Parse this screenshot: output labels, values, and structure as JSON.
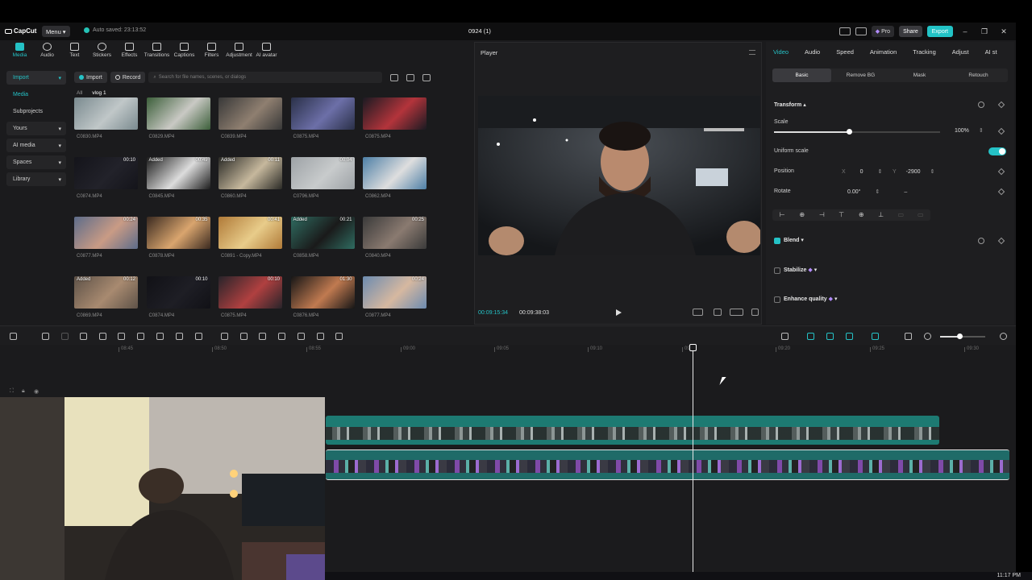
{
  "titlebar": {
    "brand": "CapCut",
    "menu_label": "Menu",
    "autosave": "Auto saved: 23:13:52",
    "project_title": "0924 (1)",
    "pro_label": "Pro",
    "share_label": "Share",
    "export_label": "Export",
    "accent_color": "#25c2c6"
  },
  "tools": [
    {
      "label": "Media",
      "icon": "media-icon"
    },
    {
      "label": "Audio",
      "icon": "audio-icon"
    },
    {
      "label": "Text",
      "icon": "text-icon"
    },
    {
      "label": "Stickers",
      "icon": "stickers-icon"
    },
    {
      "label": "Effects",
      "icon": "effects-icon"
    },
    {
      "label": "Transitions",
      "icon": "transitions-icon"
    },
    {
      "label": "Captions",
      "icon": "captions-icon"
    },
    {
      "label": "Filters",
      "icon": "filters-icon"
    },
    {
      "label": "Adjustment",
      "icon": "adjustment-icon"
    },
    {
      "label": "AI avatar",
      "icon": "ai-avatar-icon"
    }
  ],
  "leftnav": [
    {
      "label": "Import"
    },
    {
      "label": "Media"
    },
    {
      "label": "Subprojects"
    },
    {
      "label": "Yours"
    },
    {
      "label": "AI media"
    },
    {
      "label": "Spaces"
    },
    {
      "label": "Library"
    }
  ],
  "media": {
    "import_label": "Import",
    "record_label": "Record",
    "search_placeholder": "Search for file names, scenes, or dialogs",
    "crumbs": [
      "All",
      "vlog 1"
    ],
    "items": [
      {
        "name": "C0830.MP4",
        "duration": "",
        "added": ""
      },
      {
        "name": "C0829.MP4",
        "duration": "",
        "added": ""
      },
      {
        "name": "C0839.MP4",
        "duration": "",
        "added": ""
      },
      {
        "name": "C0875.MP4",
        "duration": "",
        "added": ""
      },
      {
        "name": "C0875.MP4",
        "duration": "",
        "added": ""
      },
      {
        "name": "C0874.MP4",
        "duration": "00:10",
        "added": ""
      },
      {
        "name": "C0845.MP4",
        "duration": "00:49",
        "added": "Added"
      },
      {
        "name": "C0860.MP4",
        "duration": "00:11",
        "added": "Added"
      },
      {
        "name": "C0796.MP4",
        "duration": "00:04",
        "added": ""
      },
      {
        "name": "C0862.MP4",
        "duration": "",
        "added": ""
      },
      {
        "name": "C0877.MP4",
        "duration": "00:24",
        "added": ""
      },
      {
        "name": "C0878.MP4",
        "duration": "00:35",
        "added": ""
      },
      {
        "name": "C0891 - Copy.MP4",
        "duration": "00:41",
        "added": ""
      },
      {
        "name": "C0858.MP4",
        "duration": "00:21",
        "added": "Added"
      },
      {
        "name": "C0840.MP4",
        "duration": "00:25",
        "added": ""
      },
      {
        "name": "C0869.MP4",
        "duration": "00:12",
        "added": "Added"
      },
      {
        "name": "C0874.MP4",
        "duration": "00:10",
        "added": ""
      },
      {
        "name": "C0875.MP4",
        "duration": "00:10",
        "added": ""
      },
      {
        "name": "C0876.MP4",
        "duration": "01:30",
        "added": ""
      },
      {
        "name": "C0877.MP4",
        "duration": "00:24",
        "added": ""
      }
    ]
  },
  "player": {
    "title": "Player",
    "current_time": "00:09:15:34",
    "total_time": "00:09:38:03"
  },
  "inspector": {
    "tabs": [
      "Video",
      "Audio",
      "Speed",
      "Animation",
      "Tracking",
      "Adjust",
      "AI st"
    ],
    "subtabs": [
      "Basic",
      "Remove BG",
      "Mask",
      "Retouch"
    ],
    "transform_label": "Transform",
    "scale_label": "Scale",
    "scale_value": "100%",
    "scale_fraction": 0.45,
    "uniform_label": "Uniform scale",
    "position_label": "Position",
    "pos_x_label": "X",
    "pos_x": "0",
    "pos_y_label": "Y",
    "pos_y": "-2900",
    "rotate_label": "Rotate",
    "rotate_value": "0.00°",
    "blend_label": "Blend",
    "stabilize_label": "Stabilize",
    "enhance_label": "Enhance quality"
  },
  "timeline": {
    "ticks": [
      "08:45",
      "08:50",
      "08:55",
      "09:00",
      "09:05",
      "09:10",
      "09:15",
      "09:20",
      "09:25",
      "09:30"
    ]
  },
  "taskbar": {
    "clock": "11:17 PM"
  }
}
